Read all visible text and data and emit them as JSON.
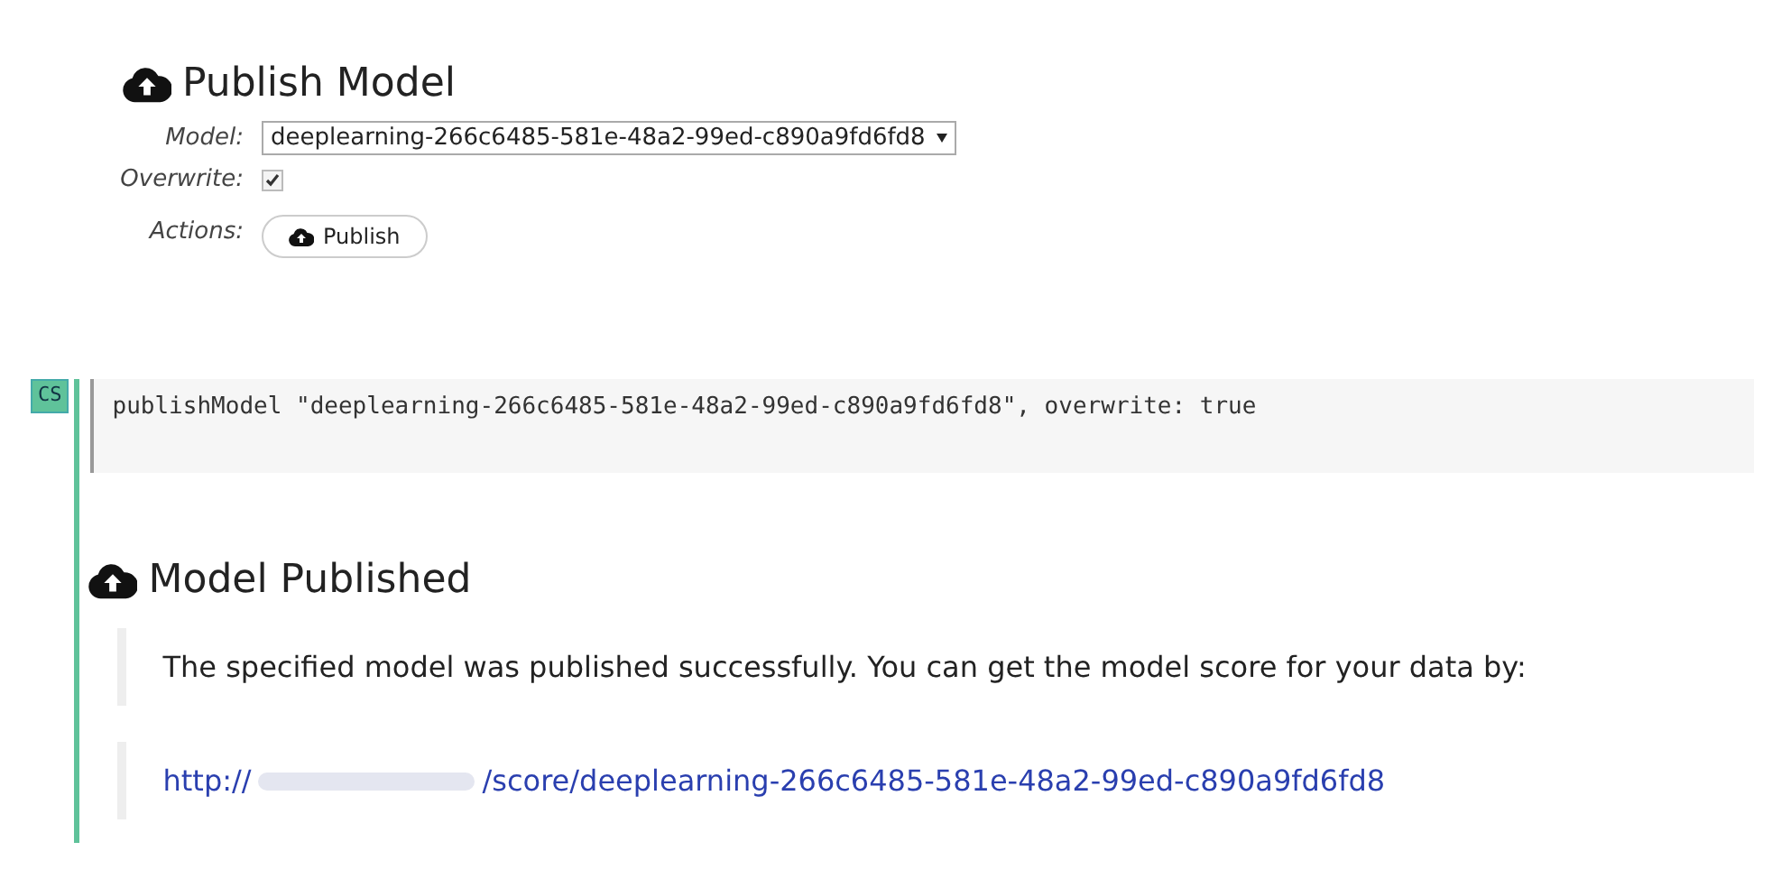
{
  "publish_form": {
    "title": "Publish Model",
    "fields": [
      {
        "kind": "select",
        "label": "Model:",
        "value": "deeplearning-266c6485-581e-48a2-99ed-c890a9fd6fd8"
      },
      {
        "kind": "checkbox",
        "label": "Overwrite:",
        "checked": true
      },
      {
        "kind": "button",
        "label": "Actions:",
        "value": "Publish"
      }
    ]
  },
  "cell": {
    "badge": "CS",
    "code": "publishModel \"deeplearning-266c6485-581e-48a2-99ed-c890a9fd6fd8\", overwrite: true"
  },
  "output": {
    "title": "Model Published",
    "message": "The specified model was published successfully. You can get the model score for your data by:",
    "link_start": "http://",
    "link_end": "/score/deeplearning-266c6485-581e-48a2-99ed-c890a9fd6fd8"
  }
}
